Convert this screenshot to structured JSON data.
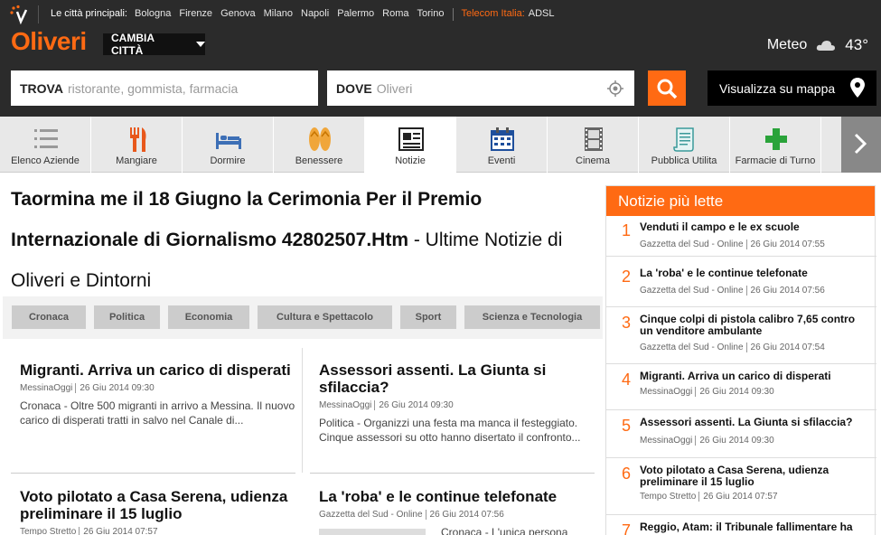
{
  "topbar": {
    "label": "Le città principali:",
    "cities": [
      "Bologna",
      "Firenze",
      "Genova",
      "Milano",
      "Napoli",
      "Palermo",
      "Roma",
      "Torino"
    ],
    "telecom": "Telecom Italia:",
    "adsl": "ADSL"
  },
  "header": {
    "brand": "Oliveri",
    "change_city": "CAMBIA CITTÀ",
    "weather_city": "Meteo",
    "weather_icon": "cloud-icon",
    "temperature": "43°"
  },
  "search": {
    "what_label": "TROVA",
    "what_placeholder": "ristorante, gommista, farmacia",
    "where_label": "DOVE",
    "where_placeholder": "Oliveri",
    "map_button": "Visualizza su mappa"
  },
  "nav": [
    {
      "label": "Elenco Aziende",
      "icon": "list-icon"
    },
    {
      "label": "Mangiare",
      "icon": "cutlery-icon"
    },
    {
      "label": "Dormire",
      "icon": "bed-icon"
    },
    {
      "label": "Benessere",
      "icon": "flip-flops-icon"
    },
    {
      "label": "Notizie",
      "icon": "newspaper-icon"
    },
    {
      "label": "Eventi",
      "icon": "calendar-icon"
    },
    {
      "label": "Cinema",
      "icon": "film-icon"
    },
    {
      "label": "Pubblica Utilita",
      "icon": "scroll-icon"
    },
    {
      "label": "Farmacie di Turno",
      "icon": "pharmacy-cross-icon"
    }
  ],
  "page": {
    "title_bold": "Taormina me il 18 Giugno la Cerimonia Per il Premio Internazionale di Giornalismo 42802507.Htm",
    "title_rest": " - Ultime Notizie di Oliveri e Dintorni"
  },
  "categories": [
    "Cronaca",
    "Politica",
    "Economia",
    "Cultura e Spettacolo",
    "Sport",
    "Scienza e Tecnologia"
  ],
  "articles": [
    {
      "title": "Migranti. Arriva un carico di disperati",
      "source": "MessinaOggi",
      "date": "26 Giu 2014 09:30",
      "summary": "Cronaca - Oltre 500 migranti in arrivo a Messina. Il nuovo carico di disperati tratti in salvo nel Canale di..."
    },
    {
      "title": "Assessori assenti. La Giunta si sfilaccia?",
      "source": "MessinaOggi",
      "date": "26 Giu 2014 09:30",
      "summary": "Politica - Organizzi una festa ma manca il festeggiato. Cinque assessori su otto hanno disertato il confronto..."
    },
    {
      "title": "Voto pilotato a Casa Serena, udienza preliminare il 15 luglio",
      "source": "Tempo Stretto",
      "date": "26 Giu 2014 07:57",
      "summary": ""
    },
    {
      "title": "La 'roba' e le continue telefonate",
      "source": "Gazzetta del Sud - Online",
      "date": "26 Giu 2014 07:56",
      "summary": "Cronaca - L'unica persona"
    }
  ],
  "most_read": {
    "heading": "Notizie più lette",
    "items": [
      {
        "n": "1",
        "title": "Venduti il campo e le ex scuole",
        "source": "Gazzetta del Sud - Online",
        "date": "26 Giu 2014 07:55"
      },
      {
        "n": "2",
        "title": "La 'roba' e le continue telefonate",
        "source": "Gazzetta del Sud - Online",
        "date": "26 Giu 2014 07:56"
      },
      {
        "n": "3",
        "title": "Cinque colpi di pistola calibro 7,65 contro un venditore ambulante",
        "source": "Gazzetta del Sud - Online",
        "date": "26 Giu 2014 07:54"
      },
      {
        "n": "4",
        "title": "Migranti. Arriva un carico di disperati",
        "source": "MessinaOggi",
        "date": "26 Giu 2014 09:30"
      },
      {
        "n": "5",
        "title": "Assessori assenti. La Giunta si sfilaccia?",
        "source": "MessinaOggi",
        "date": "26 Giu 2014 09:30"
      },
      {
        "n": "6",
        "title": "Voto pilotato a Casa Serena, udienza preliminare il 15 luglio",
        "source": "Tempo Stretto",
        "date": "26 Giu 2014 07:57"
      },
      {
        "n": "7",
        "title": "Reggio, Atam: il Tribunale fallimentare ha",
        "source": "",
        "date": ""
      }
    ]
  },
  "colors": {
    "accent": "#ff6a13",
    "dark": "#2b2b2b"
  }
}
